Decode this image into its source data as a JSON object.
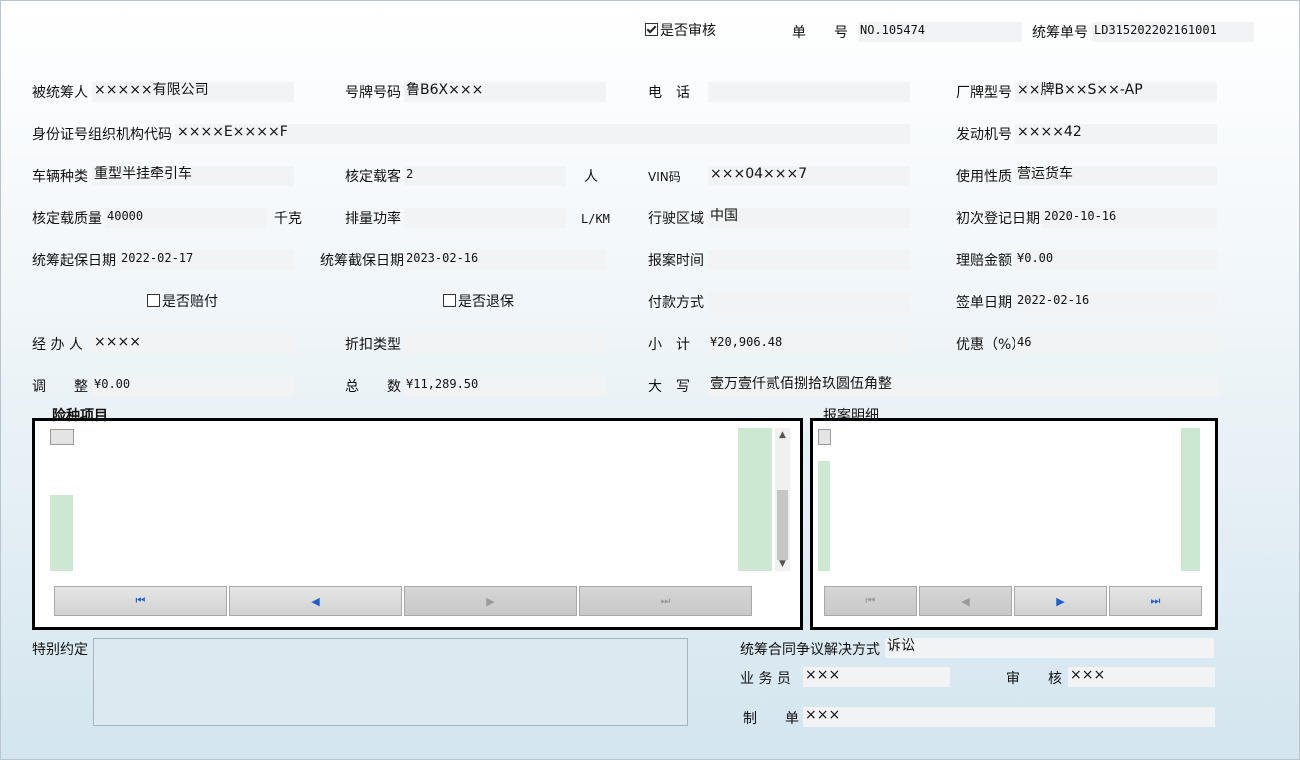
{
  "header": {
    "audit_check_label": "是否审核",
    "policy_no_label": "单　　号",
    "policy_no": "NO.105474",
    "pool_no_label": "统筹单号",
    "pool_no": "LD315202202161001"
  },
  "form": {
    "insured_label": "被统筹人",
    "insured": "×××××有限公司",
    "plate_label": "号牌号码",
    "plate": "鲁B6X×××",
    "phone_label": "电　话",
    "phone": "",
    "brand_label": "厂牌型号",
    "brand": "××牌B××S××-AP",
    "id_label": "身份证号组织机构代码",
    "id": "××××E××××F",
    "engine_label": "发动机号",
    "engine": "××××42",
    "vtype_label": "车辆种类",
    "vtype": "重型半挂牵引车",
    "seats_label": "核定载客",
    "seats": "2",
    "seats_unit": "人",
    "vin_label": "VIN码",
    "vin": "×××04×××7",
    "usage_label": "使用性质",
    "usage": "营运货车",
    "load_label": "核定载质量",
    "load": "40000",
    "load_unit": "千克",
    "displacement_label": "排量功率",
    "displacement": "",
    "displacement_unit": "L/KM",
    "region_label": "行驶区域",
    "region": "中国",
    "firstreg_label": "初次登记日期",
    "firstreg": "2020-10-16",
    "start_label": "统筹起保日期",
    "start": "2022-02-17",
    "end_label": "统筹截保日期",
    "end": "2023-02-16",
    "report_time_label": "报案时间",
    "report_time": "",
    "claim_amount_label": "理赔金额",
    "claim_amount": "¥0.00",
    "paid_check_label": "是否赔付",
    "refund_check_label": "是否退保",
    "payment_label": "付款方式",
    "payment": "",
    "sign_date_label": "签单日期",
    "sign_date": "2022-02-16",
    "handler_label": "经 办 人",
    "handler": "××××",
    "discount_type_label": "折扣类型",
    "discount_type": "",
    "subtotal_label": "小　计",
    "subtotal": "¥20,906.48",
    "discount_label": "优惠（%）",
    "discount": "46",
    "adjust_label": "调　　整",
    "adjust": "¥0.00",
    "total_label": "总　　数",
    "total": "¥11,289.50",
    "capital_label": "大　写",
    "capital": "壹万壹仟贰佰捌拾玖圆伍角整"
  },
  "panels": {
    "coverage_title": "险种项目",
    "claims_title": "报案明细",
    "nav_first": "⏮",
    "nav_prev": "◀",
    "nav_next": "▶",
    "nav_last": "⏭"
  },
  "footer": {
    "special_label": "特别约定",
    "special": "",
    "dispute_label": "统筹合同争议解决方式",
    "dispute": "诉讼",
    "salesman_label": "业 务 员",
    "salesman": "×××",
    "auditor_label": "审　　核",
    "auditor": "×××",
    "maker_label": "制　　单",
    "maker": "×××"
  },
  "checkboxes": {
    "audit": true,
    "paid": false,
    "refund": false
  },
  "colors": {
    "accent_blue": "#1a5fd0",
    "grid_green": "#cde8d2"
  }
}
